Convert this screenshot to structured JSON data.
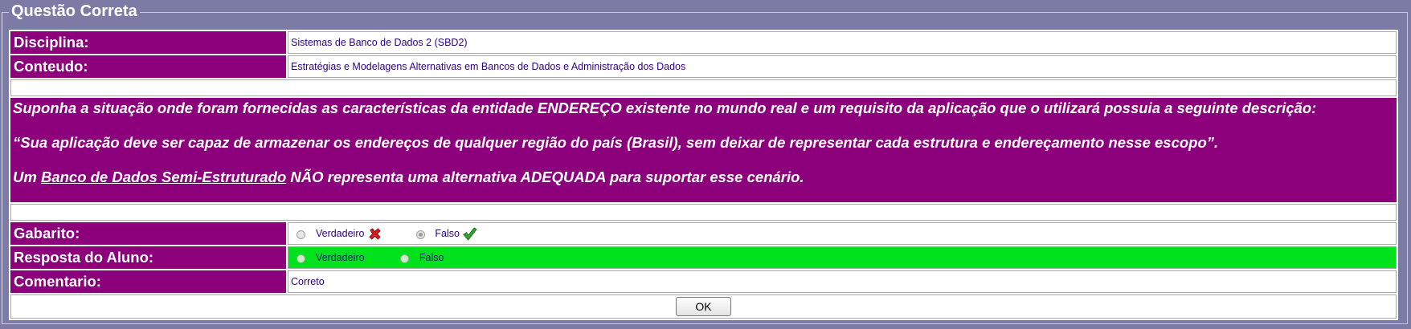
{
  "window": {
    "legend": "Questão Correta"
  },
  "fields": {
    "disciplina_label": "Disciplina:",
    "disciplina_value": "Sistemas de Banco de Dados 2 (SBD2)",
    "conteudo_label": "Conteudo:",
    "conteudo_value": "Estratégias e Modelagens Alternativas em Bancos de Dados e Administração dos Dados",
    "gabarito_label": "Gabarito:",
    "resposta_label": "Resposta do Aluno:",
    "comentario_label": "Comentario:",
    "comentario_value": "Correto"
  },
  "question": {
    "p1": "Suponha a situação onde foram fornecidas as características da entidade ENDEREÇO existente no mundo real e um requisito da aplicação que o utilizará possuia a seguinte descrição:",
    "p2": "“Sua aplicação deve ser capaz de armazenar os endereços de qualquer região do país (Brasil), sem deixar de representar cada estrutura e endereçamento nesse escopo”.",
    "p3_prefix": "Um ",
    "p3_underlined": "Banco de Dados Semi-Estruturado",
    "p3_suffix": " NÃO representa uma alternativa ADEQUADA para suportar esse cenário."
  },
  "gabarito": {
    "option_true": "Verdadeiro",
    "option_false": "Falso",
    "selected": "Falso",
    "true_icon": "red-x-icon",
    "false_icon": "green-check-icon"
  },
  "resposta": {
    "option_true": "Verdadeiro",
    "option_false": "Falso",
    "row_color": "#00e21e"
  },
  "ok_button": "OK",
  "colors": {
    "background": "#7b7ba5",
    "label_bg": "#8c007c",
    "value_text": "#2d0080",
    "correct_green": "#00e21e"
  }
}
